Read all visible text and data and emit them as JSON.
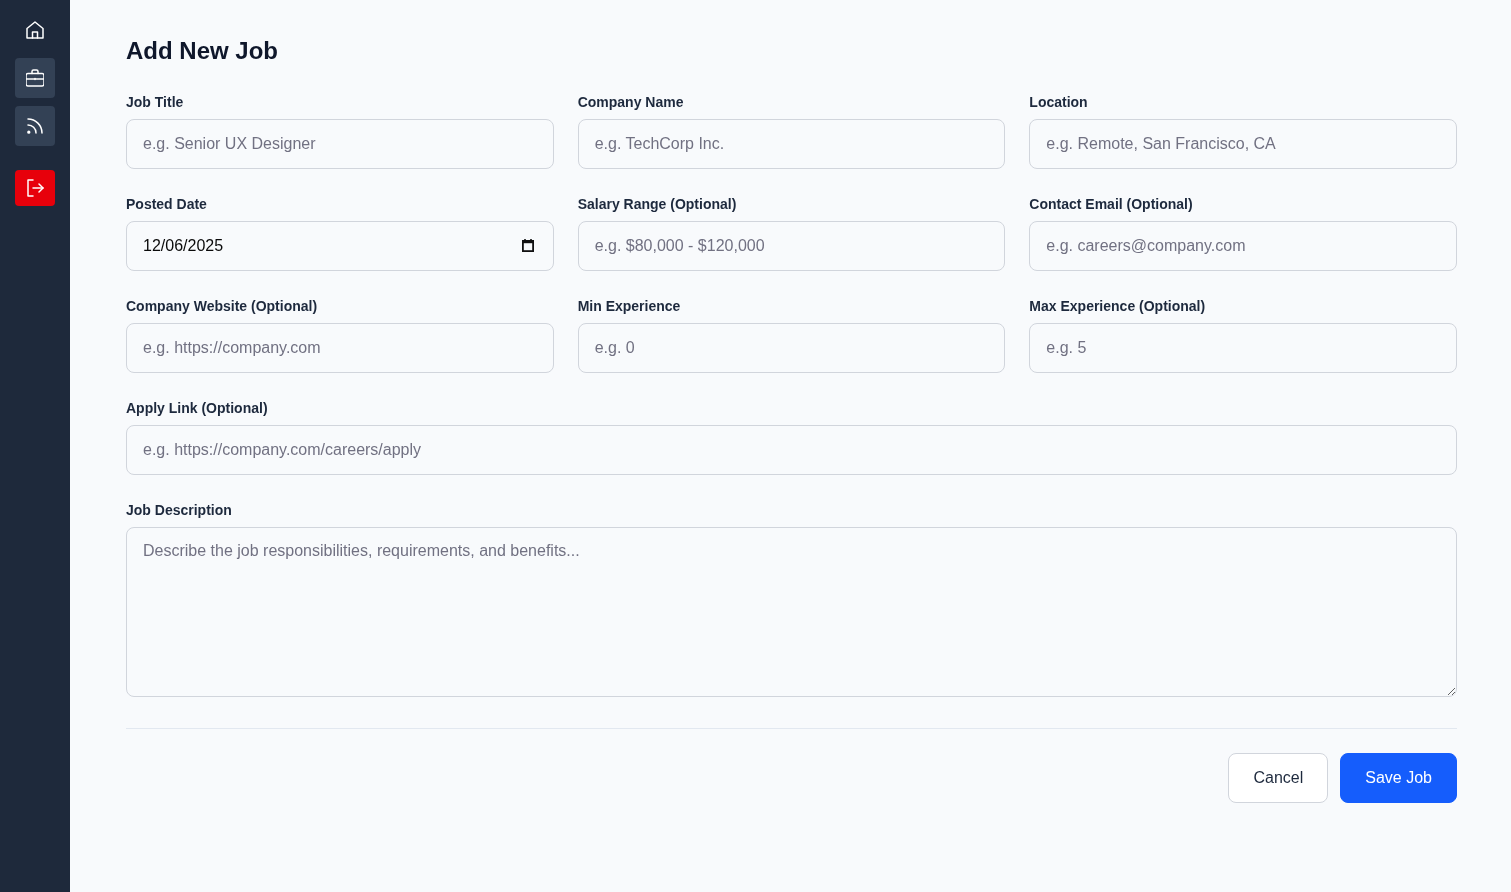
{
  "sidebar": {
    "items": [
      {
        "kind": "home",
        "selected": false
      },
      {
        "kind": "jobs",
        "selected": true
      },
      {
        "kind": "feed",
        "selected": true
      },
      {
        "kind": "logout",
        "selected": false
      }
    ]
  },
  "page": {
    "title": "Add New Job"
  },
  "form": {
    "rows": [
      [
        {
          "kind": "text",
          "label": "Job Title",
          "placeholder": "e.g. Senior UX Designer"
        },
        {
          "kind": "text",
          "label": "Company Name",
          "placeholder": "e.g. TechCorp Inc."
        },
        {
          "kind": "text",
          "label": "Location",
          "placeholder": "e.g. Remote, San Francisco, CA"
        }
      ],
      [
        {
          "kind": "date",
          "label": "Posted Date",
          "value": "12/06/2025"
        },
        {
          "kind": "text",
          "label": "Salary Range (Optional)",
          "placeholder": "e.g. $80,000 - $120,000"
        },
        {
          "kind": "text",
          "label": "Contact Email (Optional)",
          "placeholder": "e.g. careers@company.com"
        }
      ],
      [
        {
          "kind": "text",
          "label": "Company Website (Optional)",
          "placeholder": "e.g. https://company.com"
        },
        {
          "kind": "text",
          "label": "Min Experience",
          "placeholder": "e.g. 0"
        },
        {
          "kind": "text",
          "label": "Max Experience (Optional)",
          "placeholder": "e.g. 5"
        }
      ],
      [
        {
          "kind": "text",
          "label": "Apply Link (Optional)",
          "placeholder": "e.g. https://company.com/careers/apply"
        }
      ],
      [
        {
          "kind": "textarea",
          "label": "Job Description",
          "placeholder": "Describe the job responsibilities, requirements, and benefits..."
        }
      ]
    ],
    "buttons": [
      {
        "kind": "secondary",
        "label": "Cancel"
      },
      {
        "kind": "primary",
        "label": "Save Job"
      }
    ]
  }
}
